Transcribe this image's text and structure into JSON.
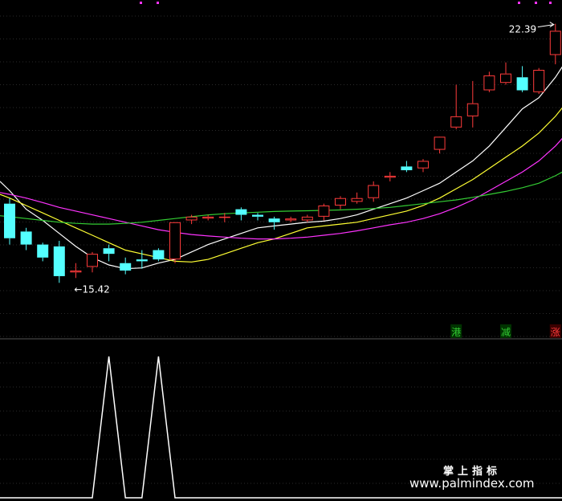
{
  "colors": {
    "background": "#000000",
    "grid": "#2a2a2a",
    "up": "#ff3b3b",
    "down": "#54ffff",
    "ma5": "#ffffff",
    "ma10": "#ffff33",
    "ma20": "#ff33ff",
    "ma60": "#33cc33",
    "indicator": "#ffffff",
    "marker": "#ff33ff"
  },
  "chart_data": [
    {
      "type": "candlestick",
      "title": "",
      "ylim": [
        14.0,
        22.9
      ],
      "candles": [
        {
          "o": 17.55,
          "h": 17.7,
          "c": 16.62,
          "l": 16.45
        },
        {
          "o": 16.8,
          "h": 16.9,
          "c": 16.45,
          "l": 16.3
        },
        {
          "o": 16.45,
          "h": 16.5,
          "c": 16.1,
          "l": 16.0
        },
        {
          "o": 16.4,
          "h": 16.55,
          "c": 15.6,
          "l": 15.42
        },
        {
          "o": 15.7,
          "h": 15.95,
          "c": 15.75,
          "l": 15.55
        },
        {
          "o": 15.85,
          "h": 16.25,
          "c": 16.2,
          "l": 15.7
        },
        {
          "o": 16.35,
          "h": 16.45,
          "c": 16.2,
          "l": 16.0
        },
        {
          "o": 15.95,
          "h": 16.1,
          "c": 15.75,
          "l": 15.65
        },
        {
          "o": 16.05,
          "h": 16.3,
          "c": 16.0,
          "l": 15.8
        },
        {
          "o": 16.3,
          "h": 16.35,
          "c": 16.05,
          "l": 16.0
        },
        {
          "o": 16.05,
          "h": 17.0,
          "c": 17.05,
          "l": 15.95
        },
        {
          "o": 17.1,
          "h": 17.25,
          "c": 17.2,
          "l": 17.0
        },
        {
          "o": 17.15,
          "h": 17.25,
          "c": 17.2,
          "l": 17.1
        },
        {
          "o": 17.2,
          "h": 17.3,
          "c": 17.2,
          "l": 17.05
        },
        {
          "o": 17.4,
          "h": 17.45,
          "c": 17.25,
          "l": 17.1
        },
        {
          "o": 17.25,
          "h": 17.3,
          "c": 17.2,
          "l": 17.1
        },
        {
          "o": 17.15,
          "h": 17.2,
          "c": 17.05,
          "l": 16.85
        },
        {
          "o": 17.1,
          "h": 17.2,
          "c": 17.15,
          "l": 17.05
        },
        {
          "o": 17.1,
          "h": 17.25,
          "c": 17.2,
          "l": 17.05
        },
        {
          "o": 17.2,
          "h": 17.55,
          "c": 17.5,
          "l": 17.1
        },
        {
          "o": 17.5,
          "h": 17.75,
          "c": 17.7,
          "l": 17.4
        },
        {
          "o": 17.6,
          "h": 17.85,
          "c": 17.7,
          "l": 17.55
        },
        {
          "o": 17.7,
          "h": 18.15,
          "c": 18.05,
          "l": 17.6
        },
        {
          "o": 18.25,
          "h": 18.4,
          "c": 18.3,
          "l": 18.15
        },
        {
          "o": 18.55,
          "h": 18.7,
          "c": 18.45,
          "l": 18.4
        },
        {
          "o": 18.5,
          "h": 18.75,
          "c": 18.7,
          "l": 18.4
        },
        {
          "o": 19.0,
          "h": 19.3,
          "c": 19.35,
          "l": 18.9
        },
        {
          "o": 19.6,
          "h": 20.75,
          "c": 19.9,
          "l": 19.55
        },
        {
          "o": 19.9,
          "h": 20.85,
          "c": 20.25,
          "l": 19.6
        },
        {
          "o": 20.6,
          "h": 21.1,
          "c": 21.0,
          "l": 20.55
        },
        {
          "o": 20.8,
          "h": 21.35,
          "c": 21.05,
          "l": 20.75
        },
        {
          "o": 20.95,
          "h": 21.25,
          "c": 20.6,
          "l": 20.55
        },
        {
          "o": 20.55,
          "h": 21.2,
          "c": 21.15,
          "l": 20.5
        },
        {
          "o": 21.55,
          "h": 22.39,
          "c": 22.2,
          "l": 21.3
        }
      ],
      "moving_averages": [
        {
          "key": "ma5",
          "values": [
            17.9,
            17.4,
            17.1,
            16.75,
            16.4,
            16.1,
            15.9,
            15.8,
            15.82,
            15.95,
            16.05,
            16.25,
            16.45,
            16.6,
            16.75,
            16.9,
            16.95,
            17.0,
            17.05,
            17.08,
            17.15,
            17.25,
            17.4,
            17.55,
            17.7,
            17.9,
            18.1,
            18.4,
            18.7,
            19.1,
            19.6,
            20.1,
            20.4,
            20.95
          ]
        },
        {
          "key": "ma10",
          "values": [
            17.7,
            17.5,
            17.3,
            17.1,
            16.9,
            16.7,
            16.5,
            16.3,
            16.2,
            16.1,
            16.0,
            15.98,
            16.05,
            16.2,
            16.35,
            16.5,
            16.6,
            16.75,
            16.9,
            16.95,
            17.0,
            17.05,
            17.15,
            17.25,
            17.35,
            17.5,
            17.7,
            17.95,
            18.2,
            18.5,
            18.8,
            19.1,
            19.45,
            19.9
          ]
        },
        {
          "key": "ma20",
          "values": [
            17.8,
            17.7,
            17.58,
            17.45,
            17.35,
            17.25,
            17.15,
            17.05,
            16.95,
            16.85,
            16.78,
            16.72,
            16.68,
            16.65,
            16.62,
            16.6,
            16.6,
            16.62,
            16.65,
            16.7,
            16.75,
            16.82,
            16.9,
            16.98,
            17.05,
            17.15,
            17.28,
            17.45,
            17.65,
            17.9,
            18.15,
            18.4,
            18.7,
            19.1
          ]
        },
        {
          "key": "ma60",
          "values": [
            17.2,
            17.15,
            17.1,
            17.05,
            17.02,
            17.0,
            17.0,
            17.02,
            17.05,
            17.1,
            17.15,
            17.2,
            17.25,
            17.28,
            17.3,
            17.32,
            17.34,
            17.35,
            17.36,
            17.37,
            17.38,
            17.4,
            17.42,
            17.45,
            17.5,
            17.55,
            17.6,
            17.65,
            17.72,
            17.8,
            17.88,
            17.98,
            18.1,
            18.3
          ]
        }
      ],
      "annotations": [
        {
          "text": "←15.42",
          "candle": 4,
          "value": 15.42
        },
        {
          "text": "22.39",
          "candle": 33,
          "value": 22.39
        }
      ],
      "badges": [
        {
          "text": "港",
          "candle": 27,
          "color": "#33cc33"
        },
        {
          "text": "减",
          "candle": 30,
          "color": "#33cc33"
        },
        {
          "text": "涨",
          "candle": 33,
          "color": "#ff3b3b"
        }
      ]
    },
    {
      "type": "line",
      "title": "",
      "ylim": [
        0,
        1
      ],
      "x": [
        0,
        1,
        2,
        3,
        4,
        5,
        6,
        7,
        8,
        9,
        10,
        11,
        12,
        13,
        14,
        15,
        16,
        17,
        18,
        19,
        20,
        21,
        22,
        23,
        24,
        25,
        26,
        27,
        28,
        29,
        30,
        31,
        32,
        33
      ],
      "values": [
        0,
        0,
        0,
        0,
        0,
        0,
        1,
        0,
        0,
        1,
        0,
        0,
        0,
        0,
        0,
        0,
        0,
        0,
        0,
        0,
        0,
        0,
        0,
        0,
        0,
        0,
        0,
        0,
        0,
        0,
        0,
        0,
        0,
        0
      ]
    }
  ],
  "watermark": {
    "line1": "掌上指标",
    "line2": "www.palmindex.com"
  }
}
